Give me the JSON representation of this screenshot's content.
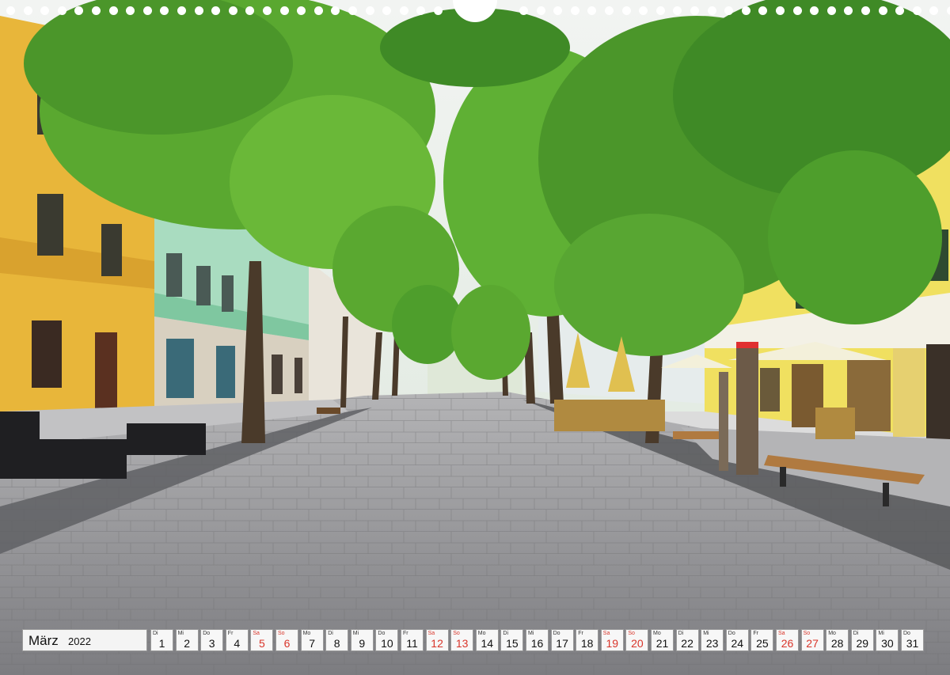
{
  "calendar": {
    "month": "März",
    "year": "2022",
    "days": [
      {
        "wd": "Di",
        "num": "1",
        "weekend": false
      },
      {
        "wd": "Mi",
        "num": "2",
        "weekend": false
      },
      {
        "wd": "Do",
        "num": "3",
        "weekend": false
      },
      {
        "wd": "Fr",
        "num": "4",
        "weekend": false
      },
      {
        "wd": "Sa",
        "num": "5",
        "weekend": true
      },
      {
        "wd": "So",
        "num": "6",
        "weekend": true
      },
      {
        "wd": "Mo",
        "num": "7",
        "weekend": false
      },
      {
        "wd": "Di",
        "num": "8",
        "weekend": false
      },
      {
        "wd": "Mi",
        "num": "9",
        "weekend": false
      },
      {
        "wd": "Do",
        "num": "10",
        "weekend": false
      },
      {
        "wd": "Fr",
        "num": "11",
        "weekend": false
      },
      {
        "wd": "Sa",
        "num": "12",
        "weekend": true
      },
      {
        "wd": "So",
        "num": "13",
        "weekend": true
      },
      {
        "wd": "Mo",
        "num": "14",
        "weekend": false
      },
      {
        "wd": "Di",
        "num": "15",
        "weekend": false
      },
      {
        "wd": "Mi",
        "num": "16",
        "weekend": false
      },
      {
        "wd": "Do",
        "num": "17",
        "weekend": false
      },
      {
        "wd": "Fr",
        "num": "18",
        "weekend": false
      },
      {
        "wd": "Sa",
        "num": "19",
        "weekend": true
      },
      {
        "wd": "So",
        "num": "20",
        "weekend": true
      },
      {
        "wd": "Mo",
        "num": "21",
        "weekend": false
      },
      {
        "wd": "Di",
        "num": "22",
        "weekend": false
      },
      {
        "wd": "Mi",
        "num": "23",
        "weekend": false
      },
      {
        "wd": "Do",
        "num": "24",
        "weekend": false
      },
      {
        "wd": "Fr",
        "num": "25",
        "weekend": false
      },
      {
        "wd": "Sa",
        "num": "26",
        "weekend": true
      },
      {
        "wd": "So",
        "num": "27",
        "weekend": true
      },
      {
        "wd": "Mo",
        "num": "28",
        "weekend": false
      },
      {
        "wd": "Di",
        "num": "29",
        "weekend": false
      },
      {
        "wd": "Mi",
        "num": "30",
        "weekend": false
      },
      {
        "wd": "Do",
        "num": "31",
        "weekend": false
      }
    ]
  },
  "colors": {
    "weekend": "#d9352a",
    "facade_yellow": "#e8b63a",
    "foliage": "#5aa830",
    "pavement": "#8a8a8c"
  }
}
